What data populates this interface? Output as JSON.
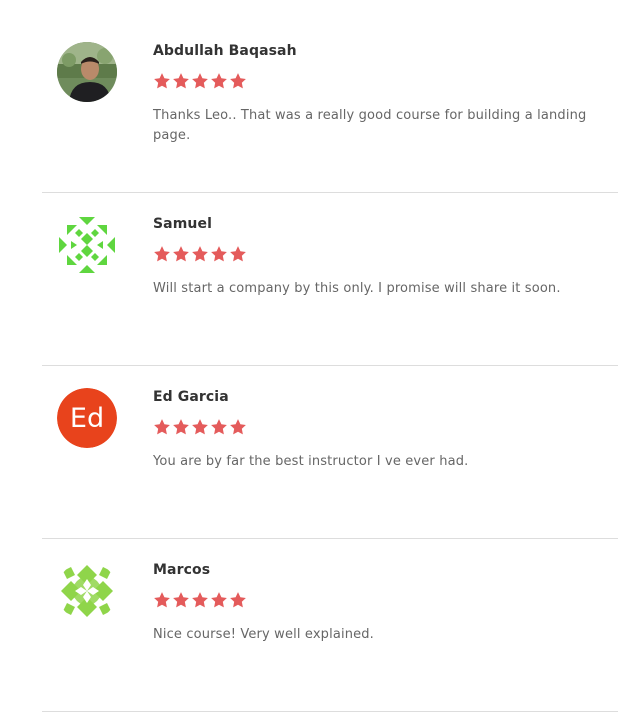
{
  "colors": {
    "star": "#e45b5b",
    "divider": "#dddddd",
    "ed_avatar_bg": "#e8431c",
    "samuel_avatar": "#5fd63f",
    "marcos_avatar": "#8fd54a"
  },
  "reviews": [
    {
      "name": "Abdullah Baqasah",
      "rating": 5,
      "comment": "Thanks Leo.. That was a really good course for building a landing page.",
      "avatar": "photo"
    },
    {
      "name": "Samuel",
      "rating": 5,
      "comment": "Will start a company by this only. I promise will share it soon.",
      "avatar": "identicon-green"
    },
    {
      "name": "Ed Garcia",
      "rating": 5,
      "comment": "You are by far the best instructor I ve ever had.",
      "avatar": "initials",
      "initials": "Ed"
    },
    {
      "name": "Marcos",
      "rating": 5,
      "comment": "Nice course! Very well explained.",
      "avatar": "identicon-lime"
    }
  ]
}
